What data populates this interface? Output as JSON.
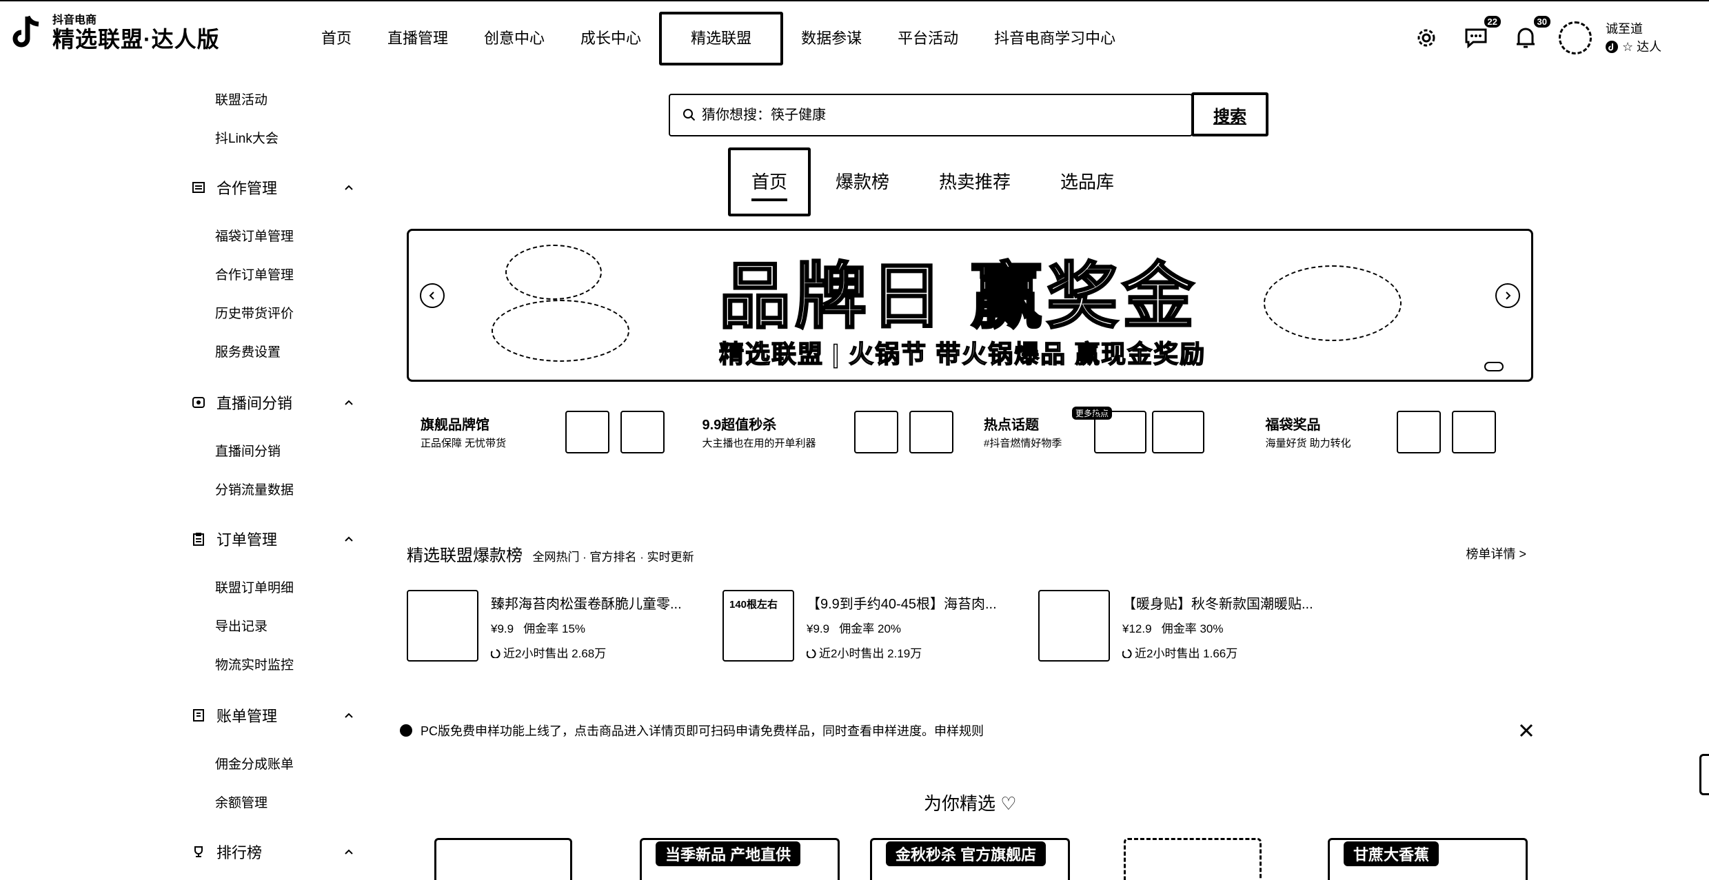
{
  "brand": {
    "sub": "抖音电商",
    "main": "精选联盟·达人版"
  },
  "nav": {
    "items": [
      "首页",
      "直播管理",
      "创意中心",
      "成长中心",
      "精选联盟",
      "数据参谋",
      "平台活动",
      "抖音电商学习中心"
    ],
    "active_index": 4
  },
  "top_right": {
    "message_badge": "22",
    "notice_badge": "30",
    "user_name": "诚至道",
    "user_role": "☆ 达人"
  },
  "sidebar": {
    "top_items": [
      "联盟活动",
      "抖Link大会"
    ],
    "groups": [
      {
        "label": "合作管理",
        "items": [
          "福袋订单管理",
          "合作订单管理",
          "历史带货评价",
          "服务费设置"
        ]
      },
      {
        "label": "直播间分销",
        "items": [
          "直播间分销",
          "分销流量数据"
        ]
      },
      {
        "label": "订单管理",
        "items": [
          "联盟订单明细",
          "导出记录",
          "物流实时监控"
        ]
      },
      {
        "label": "账单管理",
        "items": [
          "佣金分成账单",
          "余额管理"
        ]
      },
      {
        "label": "排行榜",
        "items": []
      }
    ]
  },
  "search": {
    "placeholder": "猜你想搜：筷子健康",
    "button": "搜索"
  },
  "tabs": {
    "items": [
      "首页",
      "爆款榜",
      "热卖推荐",
      "选品库"
    ],
    "active_index": 0
  },
  "banner": {
    "title": "品牌日 赢奖金",
    "subtitle": "精选联盟 | 火锅节  带火锅爆品 赢现金奖励"
  },
  "feature_cards": [
    {
      "title": "旗舰品牌馆",
      "desc": "正品保障 无忧带货",
      "tag": ""
    },
    {
      "title": "9.9超值秒杀",
      "desc": "大主播也在用的开单利器",
      "tag": ""
    },
    {
      "title": "热点话题",
      "desc": "#抖音燃情好物季",
      "tag": "更多热点"
    },
    {
      "title": "福袋奖品",
      "desc": "海量好货 助力转化",
      "tag": ""
    }
  ],
  "ranking": {
    "title": "精选联盟爆款榜",
    "subtitle": "全网热门 · 官方排名 · 实时更新",
    "link": "榜单详情 >",
    "products": [
      {
        "name": "臻邦海苔肉松蛋卷酥脆儿童零...",
        "price": "¥9.9",
        "commission": "佣金率 15%",
        "sold": "近2小时售出 2.68万",
        "img_text": ""
      },
      {
        "name": "【9.9到手约40-45根】海苔肉...",
        "price": "¥9.9",
        "commission": "佣金率 20%",
        "sold": "近2小时售出 2.19万",
        "img_text": "140根左右"
      },
      {
        "name": "【暖身贴】秋冬新款国潮暖贴...",
        "price": "¥12.9",
        "commission": "佣金率 30%",
        "sold": "近2小时售出 1.66万",
        "img_text": ""
      }
    ]
  },
  "notice": {
    "text": "PC版免费申样功能上线了，点击商品进入详情页即可扫码申请免费样品，同时查看申样进度。",
    "link": "申样规则"
  },
  "pick": {
    "title": "为你精选 ♡"
  },
  "grid_labels": [
    "",
    "当季新品 产地直供",
    "金秋秒杀 官方旗舰店",
    "",
    "甘蔗大香蕉"
  ]
}
